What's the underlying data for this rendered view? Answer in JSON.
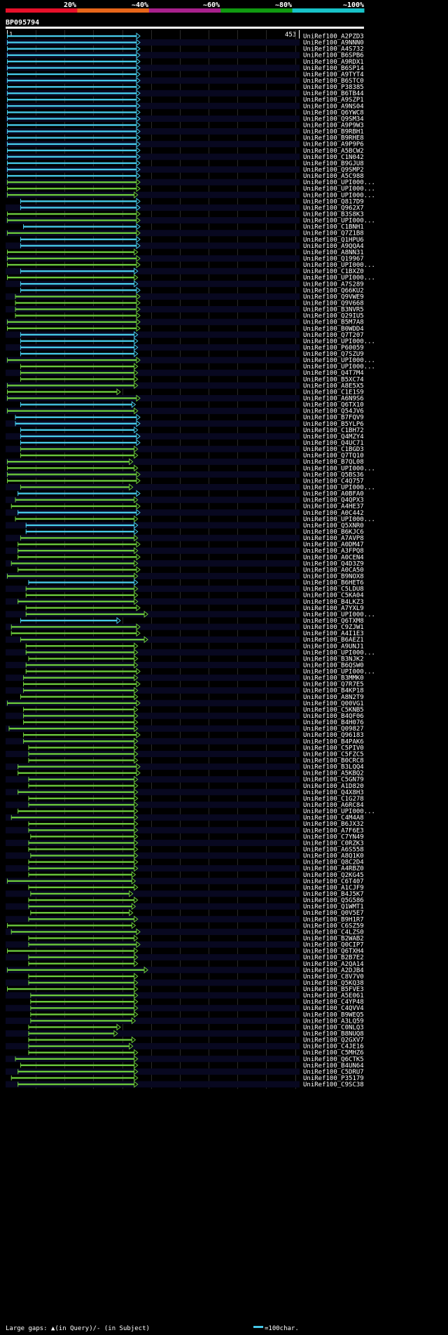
{
  "chart_data": {
    "type": "bar",
    "title": "BP095794",
    "query_start_label": "1",
    "query_end_label": "453",
    "query_length": 453,
    "identity_scale": {
      "labels": [
        "20%",
        "~40%",
        "~60%",
        "~80%",
        "~100%"
      ],
      "colors": [
        "#e8102a",
        "#e8661a",
        "#a8208c",
        "#109a10",
        "#18c2c8"
      ]
    },
    "series_colors": {
      "high": "#46c8e8",
      "low": "#6ac83c"
    },
    "footer": {
      "gaps_text": "Large gaps: ▲(in Query)/- (in Subject)",
      "scale_text": "=100char."
    },
    "hits": [
      {
        "id": "UniRef100_A2PZD3",
        "s": 1,
        "e": 453,
        "c": "h"
      },
      {
        "id": "UniRef100_A9NNN0",
        "s": 1,
        "e": 453,
        "c": "h"
      },
      {
        "id": "UniRef100_A4S732",
        "s": 1,
        "e": 453,
        "c": "h"
      },
      {
        "id": "UniRef100_B6SPB6",
        "s": 1,
        "e": 453,
        "c": "h"
      },
      {
        "id": "UniRef100_A9RDX1",
        "s": 1,
        "e": 453,
        "c": "h"
      },
      {
        "id": "UniRef100_B6SP14",
        "s": 1,
        "e": 453,
        "c": "h"
      },
      {
        "id": "UniRef100_A9TYT4",
        "s": 1,
        "e": 453,
        "c": "h"
      },
      {
        "id": "UniRef100_B6STC0",
        "s": 1,
        "e": 453,
        "c": "h"
      },
      {
        "id": "UniRef100_P38385",
        "s": 1,
        "e": 453,
        "c": "h"
      },
      {
        "id": "UniRef100_B6TB44",
        "s": 1,
        "e": 453,
        "c": "h"
      },
      {
        "id": "UniRef100_A9SZP1",
        "s": 1,
        "e": 453,
        "c": "h"
      },
      {
        "id": "UniRef100_A9NS04",
        "s": 1,
        "e": 453,
        "c": "h"
      },
      {
        "id": "UniRef100_Q6YWC8",
        "s": 1,
        "e": 453,
        "c": "h"
      },
      {
        "id": "UniRef100_Q9SM34",
        "s": 1,
        "e": 453,
        "c": "h"
      },
      {
        "id": "UniRef100_A9P9W3",
        "s": 1,
        "e": 453,
        "c": "h"
      },
      {
        "id": "UniRef100_B9RBH1",
        "s": 1,
        "e": 453,
        "c": "h"
      },
      {
        "id": "UniRef100_B9RHE8",
        "s": 1,
        "e": 453,
        "c": "h"
      },
      {
        "id": "UniRef100_A9P9P6",
        "s": 1,
        "e": 453,
        "c": "h"
      },
      {
        "id": "UniRef100_A5BCW2",
        "s": 1,
        "e": 453,
        "c": "h"
      },
      {
        "id": "UniRef100_C1N042",
        "s": 1,
        "e": 453,
        "c": "h"
      },
      {
        "id": "UniRef100_B9GJU8",
        "s": 1,
        "e": 453,
        "c": "h"
      },
      {
        "id": "UniRef100_Q9SMP2",
        "s": 1,
        "e": 453,
        "c": "h"
      },
      {
        "id": "UniRef100_A5C988",
        "s": 1,
        "e": 453,
        "c": "h"
      },
      {
        "id": "UniRef100_UPI000...",
        "s": 1,
        "e": 453,
        "c": "l"
      },
      {
        "id": "UniRef100_UPI000...",
        "s": 1,
        "e": 453,
        "c": "l"
      },
      {
        "id": "UniRef100_UPI000...",
        "s": 1,
        "e": 445,
        "c": "l"
      },
      {
        "id": "UniRef100_Q817D9",
        "s": 47,
        "e": 453,
        "c": "h"
      },
      {
        "id": "UniRef100_Q962X7",
        "s": 47,
        "e": 453,
        "c": "h"
      },
      {
        "id": "UniRef100_B3S8K3",
        "s": 1,
        "e": 453,
        "c": "l"
      },
      {
        "id": "UniRef100_UPI000...",
        "s": 1,
        "e": 453,
        "c": "l"
      },
      {
        "id": "UniRef100_C1BNH1",
        "s": 57,
        "e": 453,
        "c": "h"
      },
      {
        "id": "UniRef100_Q7Z1B8",
        "s": 1,
        "e": 453,
        "c": "l"
      },
      {
        "id": "UniRef100_Q1HPU6",
        "s": 47,
        "e": 453,
        "c": "h"
      },
      {
        "id": "UniRef100_A9QQA4",
        "s": 47,
        "e": 453,
        "c": "h"
      },
      {
        "id": "UniRef100_A8NN31",
        "s": 1,
        "e": 445,
        "c": "l"
      },
      {
        "id": "UniRef100_Q19967",
        "s": 1,
        "e": 453,
        "c": "l"
      },
      {
        "id": "UniRef100_UPI000...",
        "s": 1,
        "e": 453,
        "c": "l"
      },
      {
        "id": "UniRef100_C1BXZ0",
        "s": 47,
        "e": 445,
        "c": "h"
      },
      {
        "id": "UniRef100_UPI000...",
        "s": 1,
        "e": 445,
        "c": "l"
      },
      {
        "id": "UniRef100_A7S289",
        "s": 47,
        "e": 445,
        "c": "h"
      },
      {
        "id": "UniRef100_Q66KU2",
        "s": 47,
        "e": 453,
        "c": "h"
      },
      {
        "id": "UniRef100_Q9VWE9",
        "s": 29,
        "e": 453,
        "c": "l"
      },
      {
        "id": "UniRef100_Q9V668",
        "s": 29,
        "e": 453,
        "c": "l"
      },
      {
        "id": "UniRef100_B3NVR5",
        "s": 29,
        "e": 453,
        "c": "l"
      },
      {
        "id": "UniRef100_Q29IU5",
        "s": 29,
        "e": 453,
        "c": "l"
      },
      {
        "id": "UniRef100_B5M7A8",
        "s": 1,
        "e": 453,
        "c": "l"
      },
      {
        "id": "UniRef100_B0WDD4",
        "s": 1,
        "e": 453,
        "c": "l"
      },
      {
        "id": "UniRef100_Q7T207",
        "s": 47,
        "e": 445,
        "c": "h"
      },
      {
        "id": "UniRef100_UPI000...",
        "s": 47,
        "e": 445,
        "c": "h"
      },
      {
        "id": "UniRef100_P60059",
        "s": 47,
        "e": 445,
        "c": "h"
      },
      {
        "id": "UniRef100_Q7SZU9",
        "s": 47,
        "e": 445,
        "c": "h"
      },
      {
        "id": "UniRef100_UPI000...",
        "s": 1,
        "e": 453,
        "c": "l"
      },
      {
        "id": "UniRef100_UPI000...",
        "s": 47,
        "e": 445,
        "c": "l"
      },
      {
        "id": "UniRef100_Q4T7M4",
        "s": 47,
        "e": 445,
        "c": "l"
      },
      {
        "id": "UniRef100_B5XC74",
        "s": 47,
        "e": 445,
        "c": "l"
      },
      {
        "id": "UniRef100_A8E5X5",
        "s": 1,
        "e": 445,
        "c": "l"
      },
      {
        "id": "UniRef100_C1E1S9",
        "s": 1,
        "e": 385,
        "c": "l"
      },
      {
        "id": "UniRef100_A6N9S6",
        "s": 1,
        "e": 453,
        "c": "l"
      },
      {
        "id": "UniRef100_Q6TX10",
        "s": 47,
        "e": 437,
        "c": "h"
      },
      {
        "id": "UniRef100_Q54JV6",
        "s": 1,
        "e": 445,
        "c": "l"
      },
      {
        "id": "UniRef100_B7FQV9",
        "s": 29,
        "e": 453,
        "c": "h"
      },
      {
        "id": "UniRef100_B5YLP6",
        "s": 29,
        "e": 453,
        "c": "h"
      },
      {
        "id": "UniRef100_C1BH72",
        "s": 47,
        "e": 445,
        "c": "h"
      },
      {
        "id": "UniRef100_Q4MZY4",
        "s": 47,
        "e": 453,
        "c": "h"
      },
      {
        "id": "UniRef100_Q4UC71",
        "s": 47,
        "e": 453,
        "c": "h"
      },
      {
        "id": "UniRef100_C1BGD3",
        "s": 47,
        "e": 445,
        "c": "l"
      },
      {
        "id": "UniRef100_Q7TQ10",
        "s": 47,
        "e": 445,
        "c": "l"
      },
      {
        "id": "UniRef100_B7QL08",
        "s": 1,
        "e": 428,
        "c": "l"
      },
      {
        "id": "UniRef100_UPI000...",
        "s": 1,
        "e": 445,
        "c": "l"
      },
      {
        "id": "UniRef100_Q5BS36",
        "s": 1,
        "e": 453,
        "c": "l"
      },
      {
        "id": "UniRef100_C4Q757",
        "s": 1,
        "e": 453,
        "c": "l"
      },
      {
        "id": "UniRef100_UPI000...",
        "s": 47,
        "e": 428,
        "c": "l"
      },
      {
        "id": "UniRef100_A0BFA0",
        "s": 38,
        "e": 453,
        "c": "h"
      },
      {
        "id": "UniRef100_Q4QPX3",
        "s": 29,
        "e": 445,
        "c": "l"
      },
      {
        "id": "UniRef100_A4HE37",
        "s": 15,
        "e": 453,
        "c": "l"
      },
      {
        "id": "UniRef100_A0C442",
        "s": 38,
        "e": 453,
        "c": "h"
      },
      {
        "id": "UniRef100_UPI000...",
        "s": 29,
        "e": 445,
        "c": "l"
      },
      {
        "id": "UniRef100_Q5XNR0",
        "s": 66,
        "e": 445,
        "c": "h"
      },
      {
        "id": "UniRef100_B6KJC6",
        "s": 66,
        "e": 445,
        "c": "h"
      },
      {
        "id": "UniRef100_A7AVP8",
        "s": 47,
        "e": 445,
        "c": "l"
      },
      {
        "id": "UniRef100_A0DM47",
        "s": 38,
        "e": 453,
        "c": "l"
      },
      {
        "id": "UniRef100_A3FPQ8",
        "s": 38,
        "e": 445,
        "c": "l"
      },
      {
        "id": "UniRef100_A0CEN4",
        "s": 38,
        "e": 453,
        "c": "l"
      },
      {
        "id": "UniRef100_Q4D3Z9",
        "s": 15,
        "e": 445,
        "c": "l"
      },
      {
        "id": "UniRef100_A0CA50",
        "s": 38,
        "e": 453,
        "c": "l"
      },
      {
        "id": "UniRef100_B9NOX8",
        "s": 1,
        "e": 445,
        "c": "l"
      },
      {
        "id": "UniRef100_B6HET6",
        "s": 75,
        "e": 445,
        "c": "h"
      },
      {
        "id": "UniRef100_C5LDU8",
        "s": 66,
        "e": 445,
        "c": "l"
      },
      {
        "id": "UniRef100_C5KA04",
        "s": 66,
        "e": 445,
        "c": "l"
      },
      {
        "id": "UniRef100_B4LKZ3",
        "s": 38,
        "e": 445,
        "c": "l"
      },
      {
        "id": "UniRef100_A7YXL9",
        "s": 66,
        "e": 453,
        "c": "l"
      },
      {
        "id": "UniRef100_UPI000...",
        "s": 66,
        "e": 480,
        "c": "l"
      },
      {
        "id": "UniRef100_Q6TXM8",
        "s": 47,
        "e": 385,
        "c": "h"
      },
      {
        "id": "UniRef100_C9ZJW1",
        "s": 15,
        "e": 453,
        "c": "l"
      },
      {
        "id": "UniRef100_A4I1E3",
        "s": 15,
        "e": 453,
        "c": "l"
      },
      {
        "id": "UniRef100_B6AEZ1",
        "s": 47,
        "e": 480,
        "c": "l"
      },
      {
        "id": "UniRef100_A9UNJ1",
        "s": 66,
        "e": 445,
        "c": "l"
      },
      {
        "id": "UniRef100_UPI000...",
        "s": 66,
        "e": 445,
        "c": "l"
      },
      {
        "id": "UniRef100_B3NJK2",
        "s": 75,
        "e": 445,
        "c": "l"
      },
      {
        "id": "UniRef100_B6QSW0",
        "s": 66,
        "e": 445,
        "c": "l"
      },
      {
        "id": "UniRef100_UPI000...",
        "s": 66,
        "e": 453,
        "c": "l"
      },
      {
        "id": "UniRef100_B3MMK0",
        "s": 57,
        "e": 445,
        "c": "l"
      },
      {
        "id": "UniRef100_Q7R7E5",
        "s": 57,
        "e": 453,
        "c": "l"
      },
      {
        "id": "UniRef100_B4KP18",
        "s": 57,
        "e": 445,
        "c": "l"
      },
      {
        "id": "UniRef100_A8N2T9",
        "s": 47,
        "e": 445,
        "c": "l"
      },
      {
        "id": "UniRef100_Q00VG1",
        "s": 1,
        "e": 453,
        "c": "l"
      },
      {
        "id": "UniRef100_C5KNB5",
        "s": 57,
        "e": 445,
        "c": "l"
      },
      {
        "id": "UniRef100_B4QF06",
        "s": 57,
        "e": 445,
        "c": "l"
      },
      {
        "id": "UniRef100_B4H076",
        "s": 57,
        "e": 445,
        "c": "l"
      },
      {
        "id": "UniRef100_Q09827",
        "s": 7,
        "e": 445,
        "c": "l"
      },
      {
        "id": "UniRef100_Q96183",
        "s": 57,
        "e": 453,
        "c": "l"
      },
      {
        "id": "UniRef100_B4PAK6",
        "s": 57,
        "e": 445,
        "c": "l"
      },
      {
        "id": "UniRef100_C5PIV0",
        "s": 75,
        "e": 445,
        "c": "l"
      },
      {
        "id": "UniRef100_C5FZC5",
        "s": 75,
        "e": 445,
        "c": "l"
      },
      {
        "id": "UniRef100_B0CRC8",
        "s": 75,
        "e": 445,
        "c": "l"
      },
      {
        "id": "UniRef100_B3LQQ4",
        "s": 38,
        "e": 453,
        "c": "l"
      },
      {
        "id": "UniRef100_A5KBQ2",
        "s": 38,
        "e": 453,
        "c": "l"
      },
      {
        "id": "UniRef100_C5GN79",
        "s": 75,
        "e": 445,
        "c": "l"
      },
      {
        "id": "UniRef100_A1D820",
        "s": 75,
        "e": 445,
        "c": "l"
      },
      {
        "id": "UniRef100_Q4X8H3",
        "s": 38,
        "e": 445,
        "c": "l"
      },
      {
        "id": "UniRef100_C1G278",
        "s": 75,
        "e": 445,
        "c": "l"
      },
      {
        "id": "UniRef100_A6RC84",
        "s": 75,
        "e": 445,
        "c": "l"
      },
      {
        "id": "UniRef100_UPI000...",
        "s": 38,
        "e": 445,
        "c": "l"
      },
      {
        "id": "UniRef100_C4M4A8",
        "s": 15,
        "e": 445,
        "c": "l"
      },
      {
        "id": "UniRef100_B6JX32",
        "s": 75,
        "e": 445,
        "c": "l"
      },
      {
        "id": "UniRef100_A7F6E3",
        "s": 75,
        "e": 445,
        "c": "l"
      },
      {
        "id": "UniRef100_C7YN49",
        "s": 82,
        "e": 445,
        "c": "l"
      },
      {
        "id": "UniRef100_C0RZK3",
        "s": 75,
        "e": 445,
        "c": "l"
      },
      {
        "id": "UniRef100_A6S558",
        "s": 75,
        "e": 445,
        "c": "l"
      },
      {
        "id": "UniRef100_A8Q1K0",
        "s": 82,
        "e": 445,
        "c": "l"
      },
      {
        "id": "UniRef100_Q8C2D4",
        "s": 75,
        "e": 445,
        "c": "l"
      },
      {
        "id": "UniRef100_A4RBZ0",
        "s": 75,
        "e": 445,
        "c": "l"
      },
      {
        "id": "UniRef100_Q2KG45",
        "s": 75,
        "e": 437,
        "c": "l"
      },
      {
        "id": "UniRef100_C6T407",
        "s": 1,
        "e": 437,
        "c": "l"
      },
      {
        "id": "UniRef100_A1CJF9",
        "s": 75,
        "e": 445,
        "c": "l"
      },
      {
        "id": "UniRef100_B4J5K7",
        "s": 82,
        "e": 428,
        "c": "l"
      },
      {
        "id": "UniRef100_Q5G586",
        "s": 75,
        "e": 445,
        "c": "l"
      },
      {
        "id": "UniRef100_Q1WMT1",
        "s": 75,
        "e": 437,
        "c": "l"
      },
      {
        "id": "UniRef100_Q0V5E7",
        "s": 82,
        "e": 428,
        "c": "l"
      },
      {
        "id": "UniRef100_B9H1R7",
        "s": 75,
        "e": 445,
        "c": "l"
      },
      {
        "id": "UniRef100_C6SZ59",
        "s": 1,
        "e": 437,
        "c": "l"
      },
      {
        "id": "UniRef100_C4LZS0",
        "s": 15,
        "e": 453,
        "c": "l"
      },
      {
        "id": "UniRef100_B2WAB2",
        "s": 75,
        "e": 445,
        "c": "l"
      },
      {
        "id": "UniRef100_Q0CIP7",
        "s": 75,
        "e": 453,
        "c": "l"
      },
      {
        "id": "UniRef100_Q6TXH4",
        "s": 1,
        "e": 445,
        "c": "l"
      },
      {
        "id": "UniRef100_B2B7E2",
        "s": 75,
        "e": 445,
        "c": "l"
      },
      {
        "id": "UniRef100_A2QA14",
        "s": 75,
        "e": 445,
        "c": "l"
      },
      {
        "id": "UniRef100_A2DJB4",
        "s": 1,
        "e": 480,
        "c": "l"
      },
      {
        "id": "UniRef100_C8V7V0",
        "s": 75,
        "e": 445,
        "c": "l"
      },
      {
        "id": "UniRef100_Q5KQ38",
        "s": 75,
        "e": 445,
        "c": "l"
      },
      {
        "id": "UniRef100_B5FVE3",
        "s": 1,
        "e": 445,
        "c": "l"
      },
      {
        "id": "UniRef100_A5E061",
        "s": 82,
        "e": 445,
        "c": "l"
      },
      {
        "id": "UniRef100_C4YP48",
        "s": 82,
        "e": 445,
        "c": "l"
      },
      {
        "id": "UniRef100_C4QVV4",
        "s": 82,
        "e": 445,
        "c": "l"
      },
      {
        "id": "UniRef100_B9WEQ5",
        "s": 82,
        "e": 445,
        "c": "l"
      },
      {
        "id": "UniRef100_A3LQ59",
        "s": 82,
        "e": 437,
        "c": "l"
      },
      {
        "id": "UniRef100_C0NLQ3",
        "s": 75,
        "e": 385,
        "c": "l"
      },
      {
        "id": "UniRef100_B8NUQ8",
        "s": 75,
        "e": 375,
        "c": "l"
      },
      {
        "id": "UniRef100_Q2GXV7",
        "s": 75,
        "e": 437,
        "c": "l"
      },
      {
        "id": "UniRef100_C4JE16",
        "s": 75,
        "e": 428,
        "c": "l"
      },
      {
        "id": "UniRef100_C5MHZ6",
        "s": 75,
        "e": 445,
        "c": "l"
      },
      {
        "id": "UniRef100_Q6CTK5",
        "s": 29,
        "e": 445,
        "c": "l"
      },
      {
        "id": "UniRef100_B4UN64",
        "s": 47,
        "e": 445,
        "c": "l"
      },
      {
        "id": "UniRef100_C5DRU7",
        "s": 38,
        "e": 445,
        "c": "l"
      },
      {
        "id": "UniRef100_P35179",
        "s": 15,
        "e": 445,
        "c": "l"
      },
      {
        "id": "UniRef100_C9SC38",
        "s": 38,
        "e": 445,
        "c": "l"
      }
    ]
  }
}
